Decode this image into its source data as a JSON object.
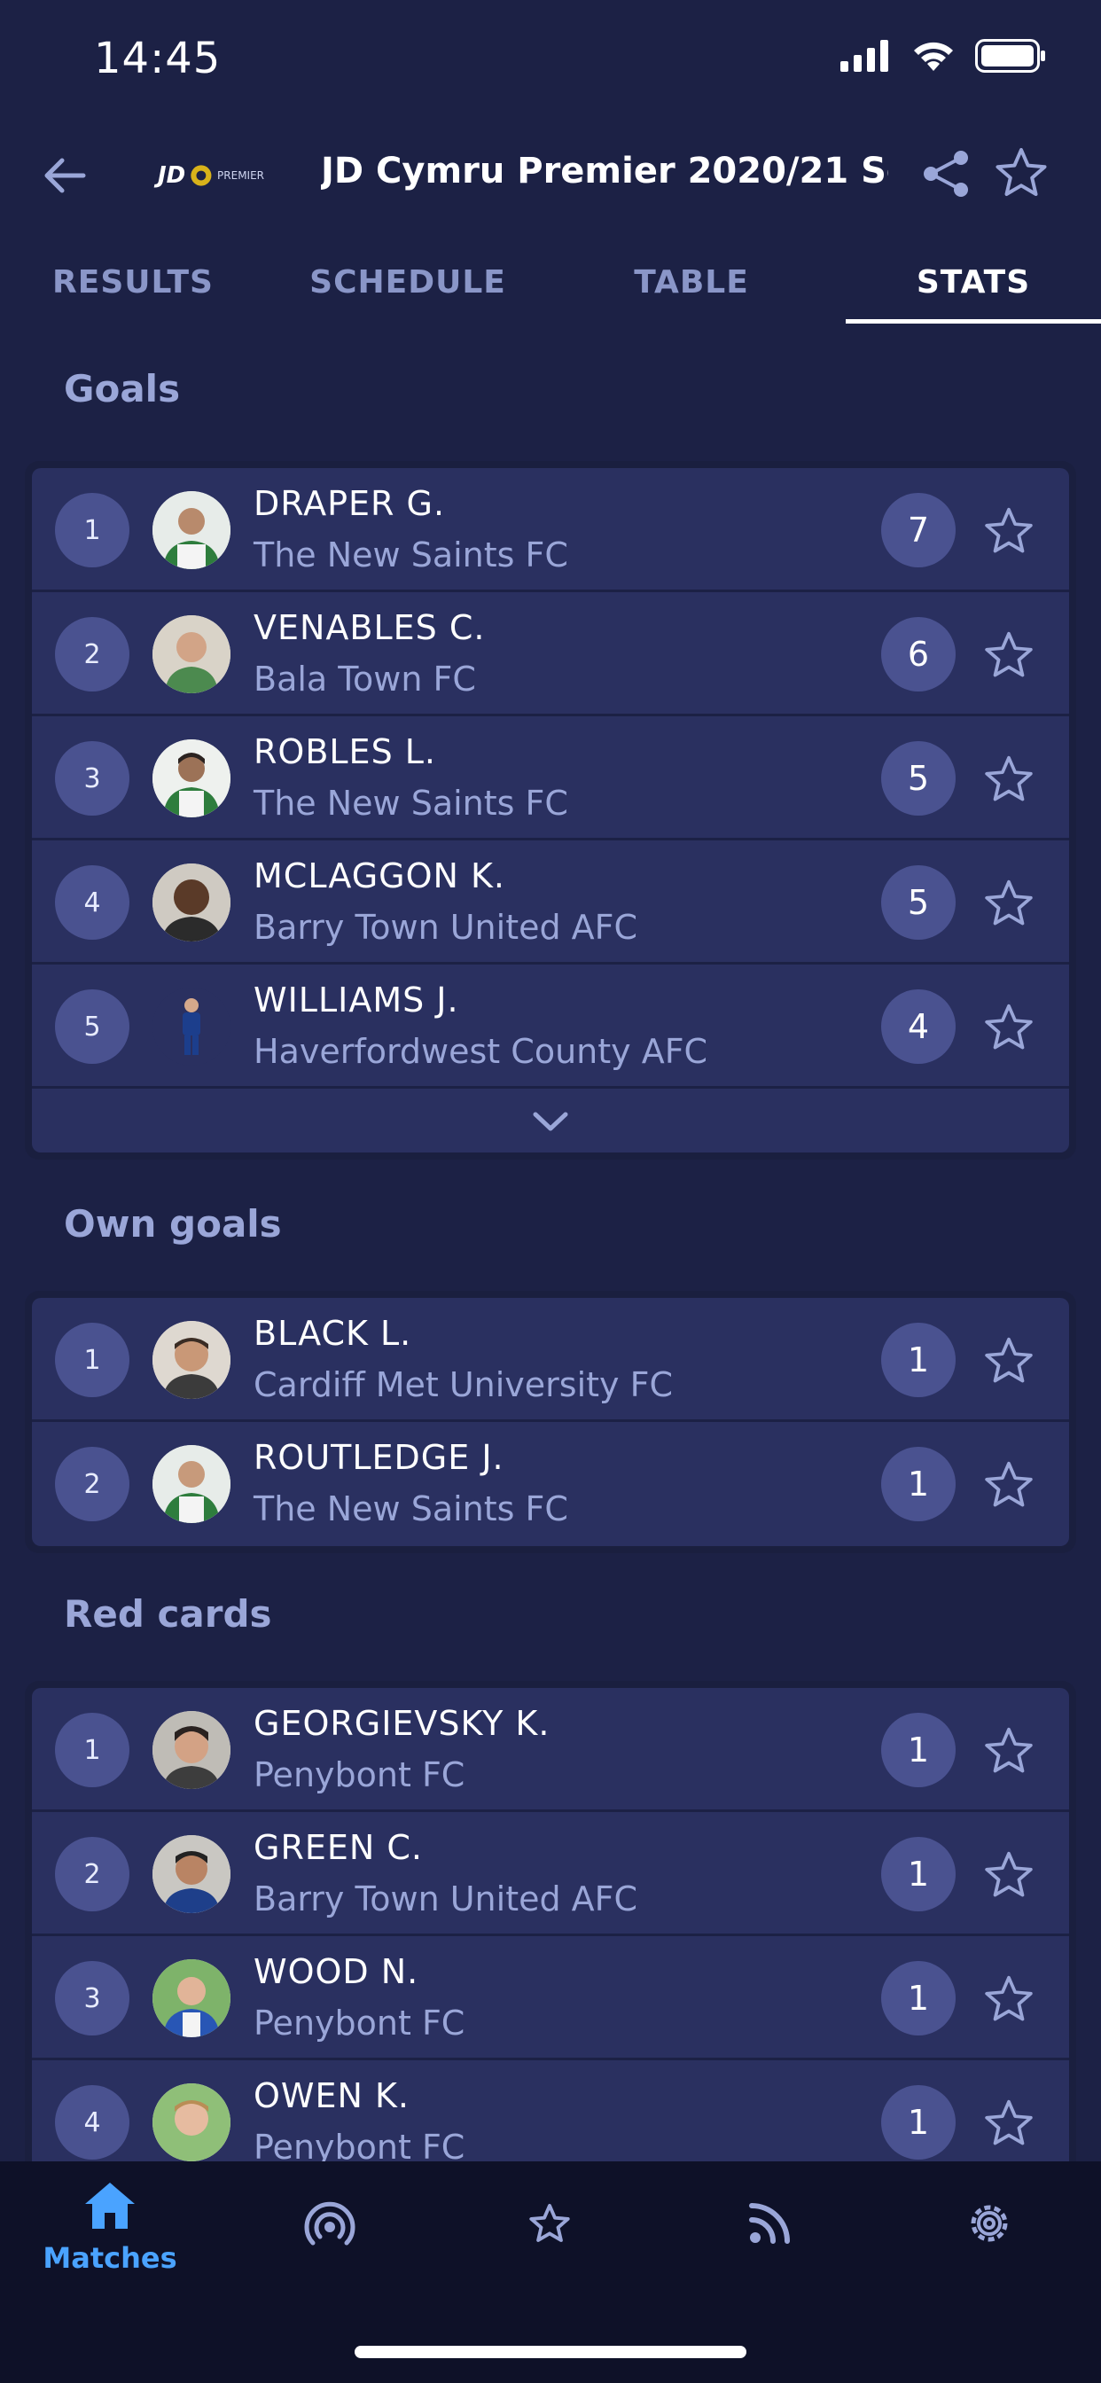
{
  "status": {
    "time": "14:45"
  },
  "header": {
    "title": "JD Cymru Premier 2020/21 Se...",
    "logo_text": "JD",
    "logo_sub": "PREMIER"
  },
  "tabs": [
    {
      "label": "RESULTS"
    },
    {
      "label": "SCHEDULE"
    },
    {
      "label": "TABLE"
    },
    {
      "label": "STATS"
    }
  ],
  "sections": [
    {
      "title": "Goals",
      "rows": [
        {
          "rank": "1",
          "name": "DRAPER G.",
          "team": "The New Saints FC",
          "value": "7"
        },
        {
          "rank": "2",
          "name": "VENABLES C.",
          "team": "Bala Town FC",
          "value": "6"
        },
        {
          "rank": "3",
          "name": "ROBLES L.",
          "team": "The New Saints FC",
          "value": "5"
        },
        {
          "rank": "4",
          "name": "MCLAGGON K.",
          "team": "Barry Town United AFC",
          "value": "5"
        },
        {
          "rank": "5",
          "name": "WILLIAMS J.",
          "team": "Haverfordwest County AFC",
          "value": "4"
        }
      ]
    },
    {
      "title": "Own goals",
      "rows": [
        {
          "rank": "1",
          "name": "BLACK L.",
          "team": "Cardiff Met University FC",
          "value": "1"
        },
        {
          "rank": "2",
          "name": "ROUTLEDGE J.",
          "team": "The New Saints FC",
          "value": "1"
        }
      ]
    },
    {
      "title": "Red cards",
      "rows": [
        {
          "rank": "1",
          "name": "GEORGIEVSKY K.",
          "team": "Penybont FC",
          "value": "1"
        },
        {
          "rank": "2",
          "name": "GREEN C.",
          "team": "Barry Town United AFC",
          "value": "1"
        },
        {
          "rank": "3",
          "name": "WOOD N.",
          "team": "Penybont FC",
          "value": "1"
        },
        {
          "rank": "4",
          "name": "OWEN K.",
          "team": "Penybont FC",
          "value": "1"
        }
      ]
    }
  ],
  "nav": {
    "matches_label": "Matches",
    "items": [
      "home-icon",
      "live-icon",
      "star-icon",
      "rss-icon",
      "gear-icon"
    ]
  },
  "colors": {
    "background": "#1c2145",
    "row": "#2a3060",
    "badge": "#4a5290",
    "accent": "#4aa3ff",
    "muted_text": "#9aa6d8"
  }
}
